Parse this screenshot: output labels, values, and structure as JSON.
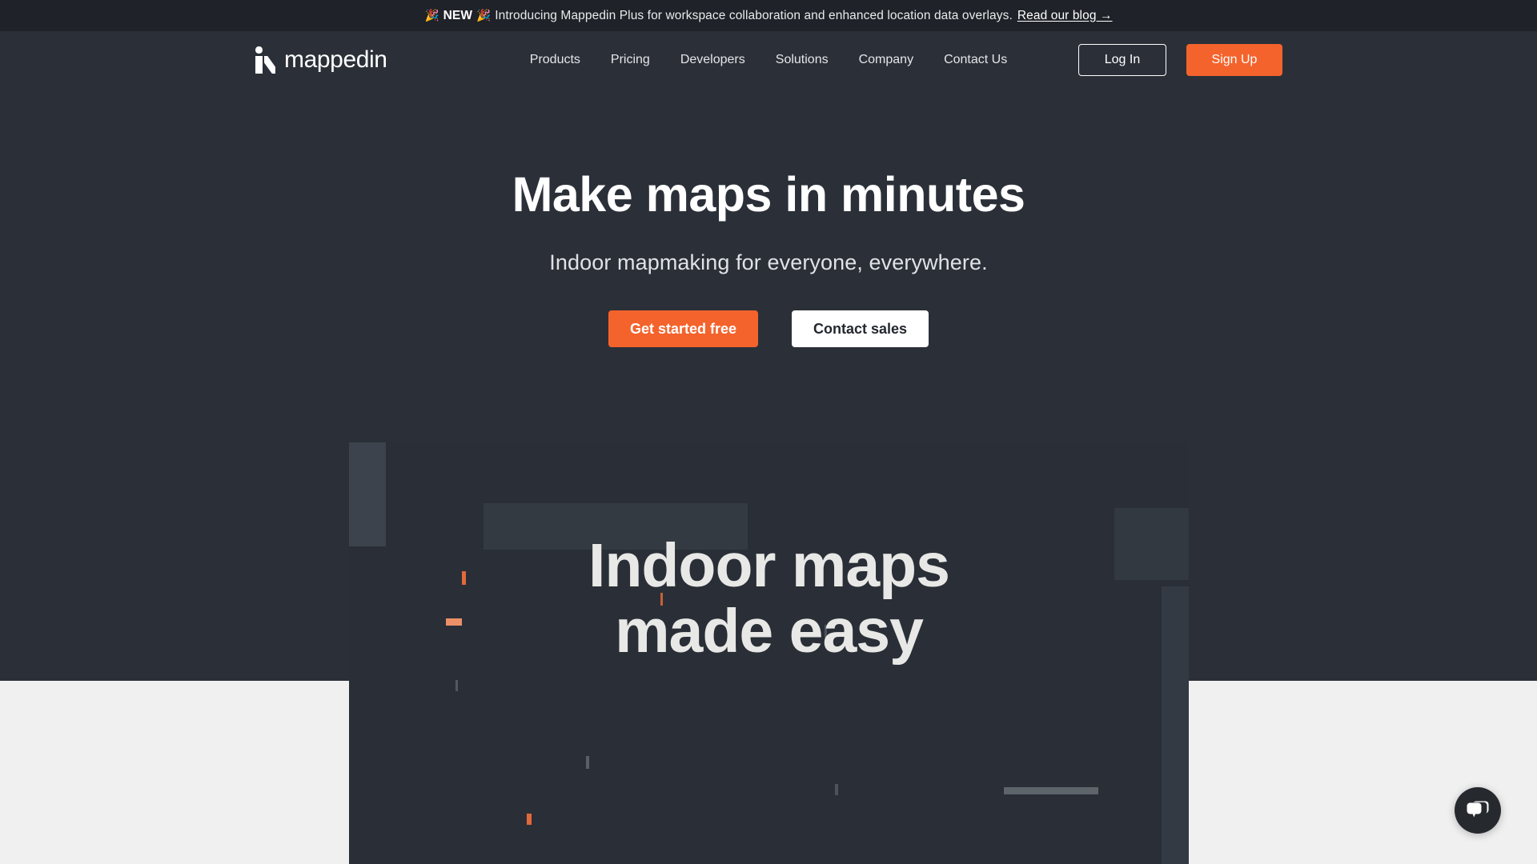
{
  "banner": {
    "emoji_left": "🎉",
    "new_label": "NEW",
    "emoji_right": "🎉",
    "message": "Introducing Mappedin Plus for workspace collaboration and enhanced location data overlays.",
    "link_label": "Read our blog →"
  },
  "header": {
    "logo_text": "mappedin",
    "nav": [
      {
        "label": "Products"
      },
      {
        "label": "Pricing"
      },
      {
        "label": "Developers"
      },
      {
        "label": "Solutions"
      },
      {
        "label": "Company"
      },
      {
        "label": "Contact Us"
      }
    ],
    "login_label": "Log In",
    "signup_label": "Sign Up"
  },
  "hero": {
    "title": "Make maps in minutes",
    "subtitle": "Indoor mapmaking for everyone, everywhere.",
    "primary_cta": "Get started free",
    "secondary_cta": "Contact sales"
  },
  "video": {
    "title_line1": "Indoor maps",
    "title_line2": "made easy"
  },
  "chat": {
    "icon": "chat-bubble-icon"
  },
  "colors": {
    "accent_orange": "#f4632c",
    "banner_bg": "#1f2228",
    "page_bg": "#2b3038",
    "panel_bg": "#2a2f37",
    "light_bg": "#f0f0f0",
    "text_light": "#ffffff",
    "video_title": "#e8e8e6"
  }
}
